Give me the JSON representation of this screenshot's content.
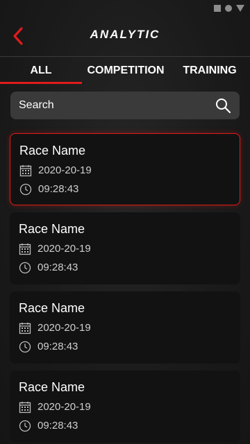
{
  "header": {
    "title": "ANALYTIC"
  },
  "tabs": [
    {
      "label": "ALL",
      "active": true
    },
    {
      "label": "COMPETITION",
      "active": false
    },
    {
      "label": "TRAINING",
      "active": false
    }
  ],
  "search": {
    "placeholder": "Search"
  },
  "races": [
    {
      "name": "Race Name",
      "date": "2020-20-19",
      "time": "09:28:43",
      "selected": true
    },
    {
      "name": "Race Name",
      "date": "2020-20-19",
      "time": "09:28:43",
      "selected": false
    },
    {
      "name": "Race Name",
      "date": "2020-20-19",
      "time": "09:28:43",
      "selected": false
    },
    {
      "name": "Race Name",
      "date": "2020-20-19",
      "time": "09:28:43",
      "selected": false
    }
  ],
  "colors": {
    "accent": "#e11b1b",
    "background": "#1c1c1c",
    "card": "#121212",
    "search_bg": "#3a3a3a"
  },
  "icons": {
    "back": "chevron-left-icon",
    "search": "search-icon",
    "date": "calendar-icon",
    "time": "clock-icon"
  }
}
